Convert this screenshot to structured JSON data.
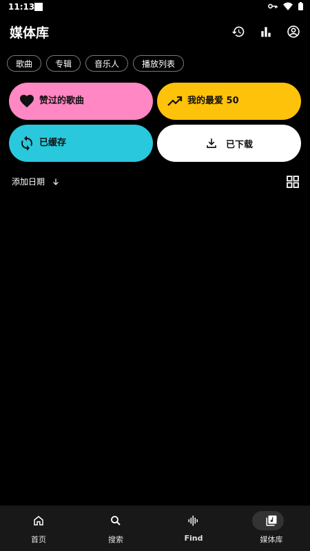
{
  "status_bar": {
    "time": "11:13"
  },
  "header": {
    "title": "媒体库"
  },
  "chips": [
    "歌曲",
    "专辑",
    "音乐人",
    "播放列表"
  ],
  "tiles": {
    "liked": {
      "label": "赞过的歌曲",
      "color": "#ff88c4"
    },
    "top50": {
      "label": "我的最爱 50",
      "color": "#ffc20a"
    },
    "cached": {
      "label": "已缓存",
      "color": "#29c8dc"
    },
    "downloaded": {
      "label": "已下载",
      "color": "#ffffff"
    }
  },
  "sort": {
    "label": "添加日期"
  },
  "bottom_nav": [
    {
      "label": "首页",
      "icon": "home-icon"
    },
    {
      "label": "搜索",
      "icon": "search-icon"
    },
    {
      "label": "Find",
      "icon": "waveform-icon"
    },
    {
      "label": "媒体库",
      "icon": "library-music-icon",
      "selected": true
    }
  ]
}
